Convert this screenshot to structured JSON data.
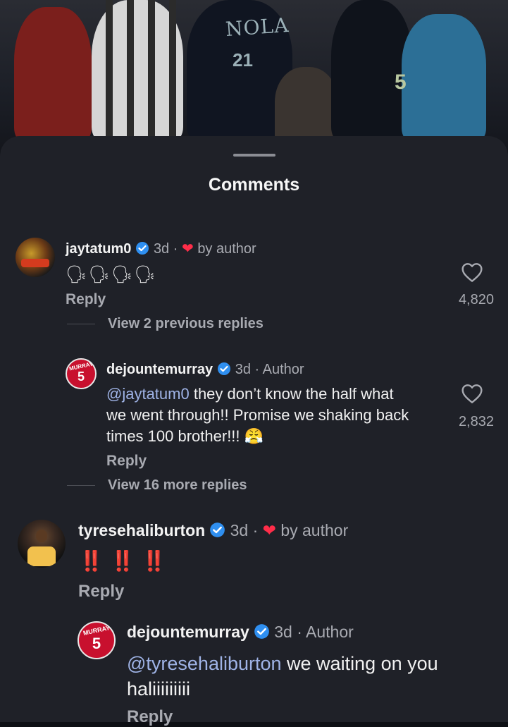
{
  "sheet": {
    "title": "Comments"
  },
  "photo": {
    "jersey_text": "NOLA",
    "jersey_number": "21",
    "jersey_number_2": "5"
  },
  "comments": [
    {
      "username": "jaytatum0",
      "time": "3d",
      "separator": "·",
      "liked_by_author": true,
      "by_author_label": "by author",
      "body_emoji": "🗣🗣🗣🗣",
      "reply_label": "Reply",
      "likes": "4,820",
      "view_replies": "View 2 previous replies"
    },
    {
      "username": "dejountemurray",
      "time": "3d",
      "separator": "·",
      "author_label": "Author",
      "mention": "@jaytatum0",
      "body": " they don’t know the half what we went through!! Promise we shaking back times 100 brother!!! 😤",
      "reply_label": "Reply",
      "likes": "2,832",
      "view_replies": "View 16 more replies",
      "avatar_text": "MURRAY",
      "avatar_number": "5"
    },
    {
      "username": "tyresehaliburton",
      "time": "3d",
      "separator": "·",
      "liked_by_author": true,
      "by_author_label": "by author",
      "body_emoji": "‼️ ‼️ ‼️",
      "reply_label": "Reply"
    },
    {
      "username": "dejountemurray",
      "time": "3d",
      "separator": "·",
      "author_label": "Author",
      "mention": "@tyresehaliburton",
      "body": " we waiting on you haliiiiiiiii",
      "reply_label": "Reply",
      "avatar_text": "MURRAY",
      "avatar_number": "5"
    }
  ],
  "colors": {
    "sheet_bg": "#1f2128",
    "accent_mention": "#9fb3e6",
    "verified_blue": "#2f8ff0",
    "heart_red": "#ff2d49",
    "jersey_red": "#c8102e"
  }
}
